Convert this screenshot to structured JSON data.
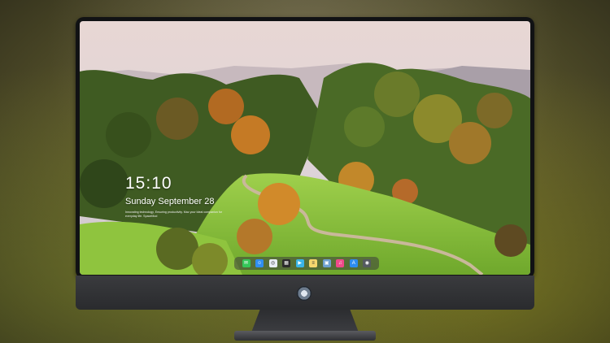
{
  "lock_screen": {
    "time": "15:10",
    "date": "Sunday September 28",
    "tagline": "Innovating technology, Ensuring productivity. Mac your Ideal companion for everyday life. SpaceMod"
  },
  "dock": {
    "items": [
      {
        "name": "messages-icon",
        "color": "#35c759",
        "glyph": "✉"
      },
      {
        "name": "finder-icon",
        "color": "#2f8ef0",
        "glyph": "☺"
      },
      {
        "name": "safari-icon",
        "color": "#e9eef5",
        "glyph": "◎"
      },
      {
        "name": "launchpad-icon",
        "color": "#2b2b2b",
        "glyph": "▦"
      },
      {
        "name": "facetime-icon",
        "color": "#3bb5e8",
        "glyph": "▶"
      },
      {
        "name": "notes-icon",
        "color": "#f5d76e",
        "glyph": "≡"
      },
      {
        "name": "preview-icon",
        "color": "#6ea0d0",
        "glyph": "▣"
      },
      {
        "name": "music-icon",
        "color": "#f04a8a",
        "glyph": "♫"
      },
      {
        "name": "app-store-icon",
        "color": "#2d8cf0",
        "glyph": "A"
      },
      {
        "name": "camera-icon",
        "color": "#555a60",
        "glyph": "◉"
      }
    ]
  }
}
